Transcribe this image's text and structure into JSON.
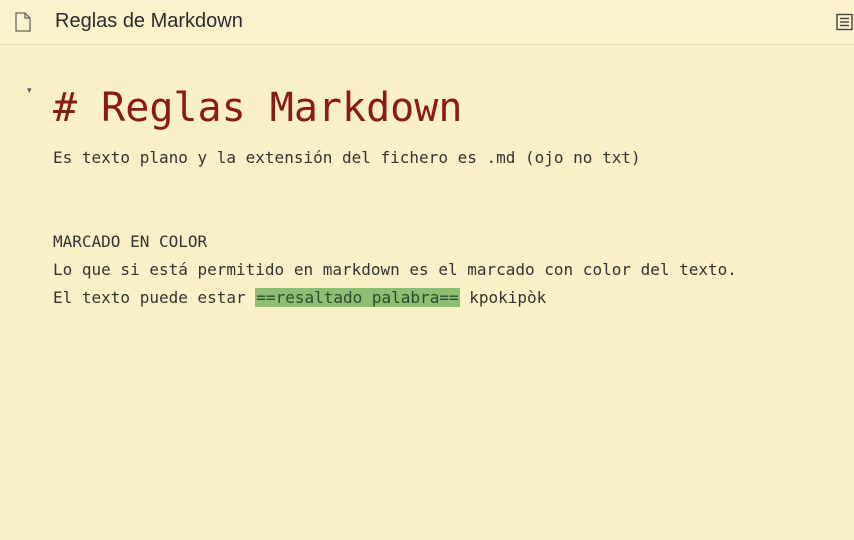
{
  "header": {
    "title": "Reglas de Markdown",
    "file_icon": "file-icon",
    "outline_icon": "outline-icon"
  },
  "editor": {
    "fold_marker": "▾",
    "heading": "# Reglas Markdown",
    "paragraph1": "Es texto plano y la extensión del fichero es .md (ojo no txt)",
    "section_title": "MARCADO EN COLOR",
    "paragraph2": "Lo que si está permitido en markdown es el marcado con color del texto.",
    "paragraph3_prefix": "El texto puede estar ",
    "paragraph3_highlight": "==resaltado palabra==",
    "paragraph3_suffix": " kpokipòk"
  },
  "colors": {
    "background": "#faf0c8",
    "heading": "#8b1a10",
    "highlight": "#8bbd73"
  }
}
